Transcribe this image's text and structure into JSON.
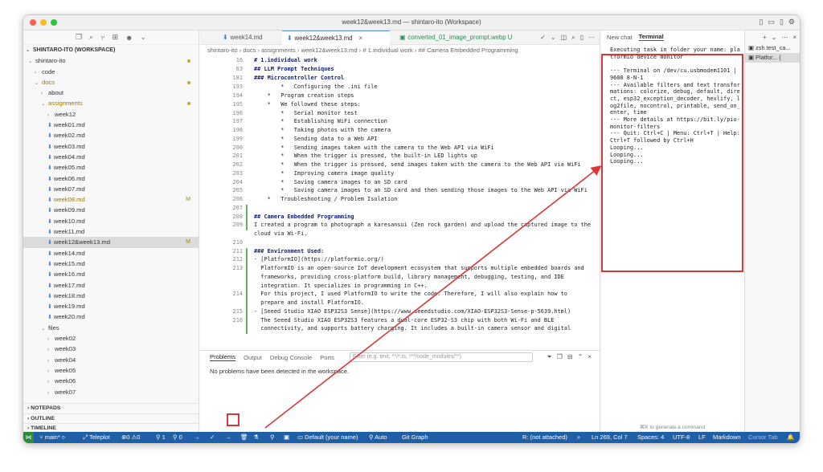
{
  "window": {
    "title": "week12&week13.md — shintaro-ito (Workspace)"
  },
  "sidebar": {
    "workspace": "SHINTARO-ITO (WORKSPACE)",
    "rows": [
      {
        "label": "shintaro-ito",
        "type": "folder-open",
        "depth": 1,
        "dot": true
      },
      {
        "label": "code",
        "type": "folder",
        "depth": 2
      },
      {
        "label": "docs",
        "type": "folder-open",
        "depth": 2,
        "dot": true,
        "mod": true
      },
      {
        "label": "about",
        "type": "folder",
        "depth": 3
      },
      {
        "label": "assignments",
        "type": "folder-open",
        "depth": 3,
        "dot": true,
        "mod": true
      },
      {
        "label": "week12",
        "type": "folder",
        "depth": 4
      },
      {
        "label": "week01.md",
        "type": "file",
        "depth": 4
      },
      {
        "label": "week02.md",
        "type": "file",
        "depth": 4
      },
      {
        "label": "week03.md",
        "type": "file",
        "depth": 4
      },
      {
        "label": "week04.md",
        "type": "file",
        "depth": 4
      },
      {
        "label": "week05.md",
        "type": "file",
        "depth": 4
      },
      {
        "label": "week06.md",
        "type": "file",
        "depth": 4
      },
      {
        "label": "week07.md",
        "type": "file",
        "depth": 4
      },
      {
        "label": "week08.md",
        "type": "file",
        "depth": 4,
        "badge": "M",
        "mod": true
      },
      {
        "label": "week09.md",
        "type": "file",
        "depth": 4
      },
      {
        "label": "week10.md",
        "type": "file",
        "depth": 4
      },
      {
        "label": "week11.md",
        "type": "file",
        "depth": 4
      },
      {
        "label": "week12&week13.md",
        "type": "file",
        "depth": 4,
        "badge": "M",
        "selected": true
      },
      {
        "label": "week14.md",
        "type": "file",
        "depth": 4
      },
      {
        "label": "week15.md",
        "type": "file",
        "depth": 4
      },
      {
        "label": "week16.md",
        "type": "file",
        "depth": 4
      },
      {
        "label": "week17.md",
        "type": "file",
        "depth": 4
      },
      {
        "label": "week18.md",
        "type": "file",
        "depth": 4
      },
      {
        "label": "week19.md",
        "type": "file",
        "depth": 4
      },
      {
        "label": "week20.md",
        "type": "file",
        "depth": 4
      },
      {
        "label": "files",
        "type": "folder-open",
        "depth": 3
      },
      {
        "label": "week02",
        "type": "folder",
        "depth": 4
      },
      {
        "label": "week03",
        "type": "folder",
        "depth": 4
      },
      {
        "label": "week04",
        "type": "folder",
        "depth": 4
      },
      {
        "label": "week05",
        "type": "folder",
        "depth": 4
      },
      {
        "label": "week06",
        "type": "folder",
        "depth": 4
      },
      {
        "label": "week07",
        "type": "folder",
        "depth": 4
      }
    ],
    "sections": [
      "NOTEPADS",
      "OUTLINE",
      "TIMELINE"
    ]
  },
  "tabs": [
    {
      "label": "week14.md",
      "active": false
    },
    {
      "label": "week12&week13.md",
      "active": true
    },
    {
      "label": "converted_01_image_prompt.webp",
      "active": false,
      "suffix": "U"
    }
  ],
  "breadcrumb": "shintaro-ito  ›  docs  ›  assignments  ›  week12&week13.md  ›  # 1.individual work  ›  ## Camera Embedded Programming",
  "code": {
    "sticky": [
      {
        "n": "16",
        "t": "# 1.individual work"
      },
      {
        "n": "63",
        "t": "## LLM Prompt Techniques"
      },
      {
        "n": "181",
        "t": "### Microcontroller Control"
      }
    ],
    "lines": [
      {
        "n": "193",
        "t": "        *   Configuring the .ini file"
      },
      {
        "n": "194",
        "t": "    *   Program creation steps"
      },
      {
        "n": "195",
        "t": "    *   We followed these steps:"
      },
      {
        "n": "196",
        "t": "        *   Serial monitor test"
      },
      {
        "n": "197",
        "t": "        *   Establishing WiFi connection"
      },
      {
        "n": "198",
        "t": "        *   Taking photos with the camera"
      },
      {
        "n": "199",
        "t": "        *   Sending data to a Web API"
      },
      {
        "n": "200",
        "t": "        *   Sending images taken with the camera to the Web API via WiFi"
      },
      {
        "n": "201",
        "t": "        *   When the trigger is pressed, the built-in LED lights up"
      },
      {
        "n": "202",
        "t": "        *   When the trigger is pressed, send images taken with the camera to the Web API via WiFi"
      },
      {
        "n": "203",
        "t": "        *   Improving camera image quality"
      },
      {
        "n": "204",
        "t": "        *   Saving camera images to an SD card"
      },
      {
        "n": "205",
        "t": "        *   Saving camera images to an SD card and then sending those images to the Web API via WiFi"
      },
      {
        "n": "206",
        "t": "    *   Troubleshooting / Problem Isolation"
      },
      {
        "n": "207",
        "t": ""
      },
      {
        "n": "208",
        "t": "## Camera Embedded Programming",
        "h": true
      },
      {
        "n": "209",
        "t": "I created a program to photograph a karesansui (Zen rock garden) and upload the captured image to the"
      },
      {
        "n": "",
        "t": "cloud via Wi-Fi."
      },
      {
        "n": "210",
        "t": ""
      },
      {
        "n": "211",
        "t": "### Environment Used:",
        "h": true
      },
      {
        "n": "212",
        "t": "- [PlatformIO](https://platformio.org/)"
      },
      {
        "n": "213",
        "t": "  PlatformIO is an open-source IoT development ecosystem that supports multiple embedded boards and"
      },
      {
        "n": "",
        "t": "  frameworks, providing cross-platform build, library management, debugging, testing, and IDE"
      },
      {
        "n": "",
        "t": "  integration. It specializes in programming in C++."
      },
      {
        "n": "214",
        "t": "  For this project, I used PlatformIO to write the code. Therefore, I will also explain how to"
      },
      {
        "n": "",
        "t": "  prepare and install PlatformIO."
      },
      {
        "n": "215",
        "t": "- [Seeed Studio XIAO ESP32S3 Sense](https://www.seeedstudio.com/XIAO-ESP32S3-Sense-p-5639.html)"
      },
      {
        "n": "216",
        "t": "  The Seeed Studio XIAO ESP32S3 features a dual-core ESP32-S3 chip with both Wi-Fi and BLE"
      },
      {
        "n": "",
        "t": "  connectivity, and supports battery charging. It includes a built-in camera sensor and digital"
      }
    ]
  },
  "panel": {
    "tabs": [
      "Problems",
      "Output",
      "Debug Console",
      "Ports"
    ],
    "filter_placeholder": "Filter (e.g. text, **/*.ts, !**/node_modules/**)",
    "message": "No problems have been detected in the workspace."
  },
  "right": {
    "tabs": [
      "New chat",
      "Terminal"
    ],
    "terminal_lines": [
      "Executing task in folder your name: platformio device monitor",
      "",
      "--- Terminal on /dev/cu.usbmodem1101 | 9600 8-N-1",
      "--- Available filters and text transformations: colorize, debug, default, direct, esp32_exception_decoder, hexlify, log2file, nocontrol, printable, send_on_enter, time",
      "--- More details at https://bit.ly/pio-monitor-filters",
      "--- Quit: Ctrl+C | Menu: Ctrl+T | Help: Ctrl+T followed by Ctrl+H",
      "Looping...",
      "Looping...",
      "Looping..."
    ],
    "footer": "⌘K to generate a command"
  },
  "terminal_list": [
    "zsh test_ca...",
    "Platfor...  ("
  ],
  "status": {
    "branch": "main*",
    "teleplot": "Teleplot",
    "problems": "⊗0 ⚠0",
    "ports": "1",
    "workers": "0",
    "profile": "Default (your name)",
    "auto": "Auto",
    "gitgraph": "Git Graph",
    "r_status": "R: (not attached)",
    "position": "Ln 269, Col 7",
    "spaces": "Spaces: 4",
    "encoding": "UTF-8",
    "eol": "LF",
    "language": "Markdown",
    "cursor_tab": "Cursor Tab"
  },
  "colors": {
    "accent": "#1e5fa8",
    "highlight": "#d9383b",
    "remote": "#2f8b3a"
  }
}
